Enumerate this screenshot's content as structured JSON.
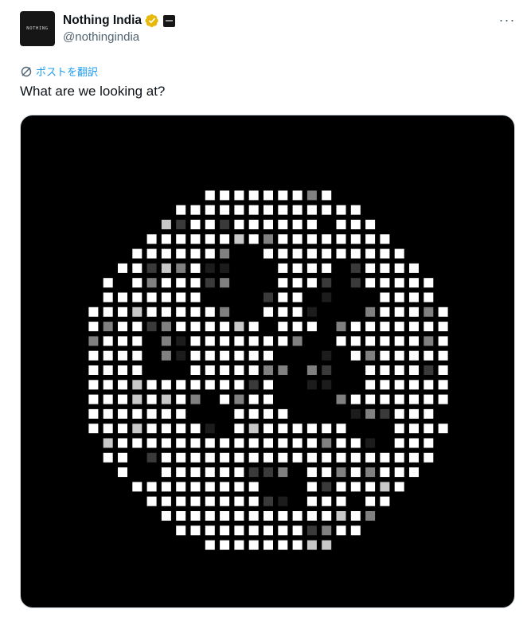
{
  "author": {
    "display_name": "Nothing India",
    "handle": "@nothingindia",
    "avatar_text": "NOTHING",
    "verified_color": "#e8b90d",
    "verified_icon": "gold-verified-badge",
    "affiliate_icon": "nothing-affiliate-badge"
  },
  "actions": {
    "more_icon": "more-horizontal-icon",
    "more_label": "···"
  },
  "translate": {
    "label": "ポストを翻訳",
    "icon": "translate-globe-icon",
    "color": "#1d9bf0"
  },
  "tweet": {
    "text": "What are we looking at?"
  },
  "media": {
    "description_icon": "dot-matrix-globe-image",
    "background": "#000000",
    "pixel_colors": [
      "#000000",
      "#ffffff",
      "#808080",
      "#3a3a3a",
      "#1c1c1c",
      "#c8c8c8"
    ]
  }
}
